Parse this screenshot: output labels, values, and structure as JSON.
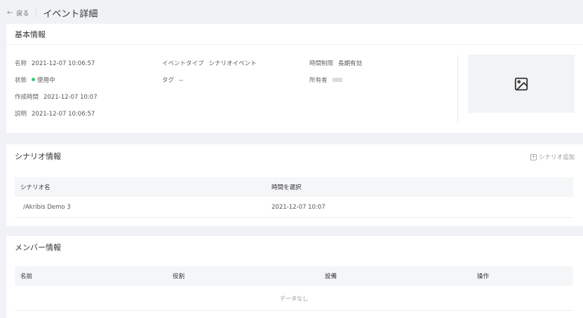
{
  "header": {
    "back_label": "戻る",
    "title": "イベント詳細"
  },
  "basic": {
    "title": "基本情報",
    "name_label": "名称",
    "name_value": "2021-12-07 10:06:57",
    "status_label": "状態",
    "status_value": "使用中",
    "created_label": "作成時間",
    "created_value": "2021-12-07 10:07",
    "desc_label": "説明",
    "desc_value": "2021-12-07 10:06:57",
    "event_type_label": "イベントタイプ",
    "event_type_value": "シナリオイベント",
    "tag_label": "タグ",
    "tag_value": "--",
    "time_limit_label": "時間制限",
    "time_limit_value": "長期有効",
    "owner_label": "所有者"
  },
  "scenario": {
    "title": "シナリオ情報",
    "add_label": "シナリオ追加",
    "columns": [
      "シナリオ名",
      "時間を選択"
    ],
    "rows": [
      [
        "/Akribis Demo 3",
        "2021-12-07 10:07"
      ]
    ]
  },
  "members": {
    "title": "メンバー情報",
    "columns": [
      "名前",
      "役割",
      "設備",
      "操作"
    ],
    "empty_text": "データなし"
  },
  "colors": {
    "status_dot": "#2ecc71",
    "background": "#f0f2f5",
    "table_header": "#f5f6f8"
  }
}
